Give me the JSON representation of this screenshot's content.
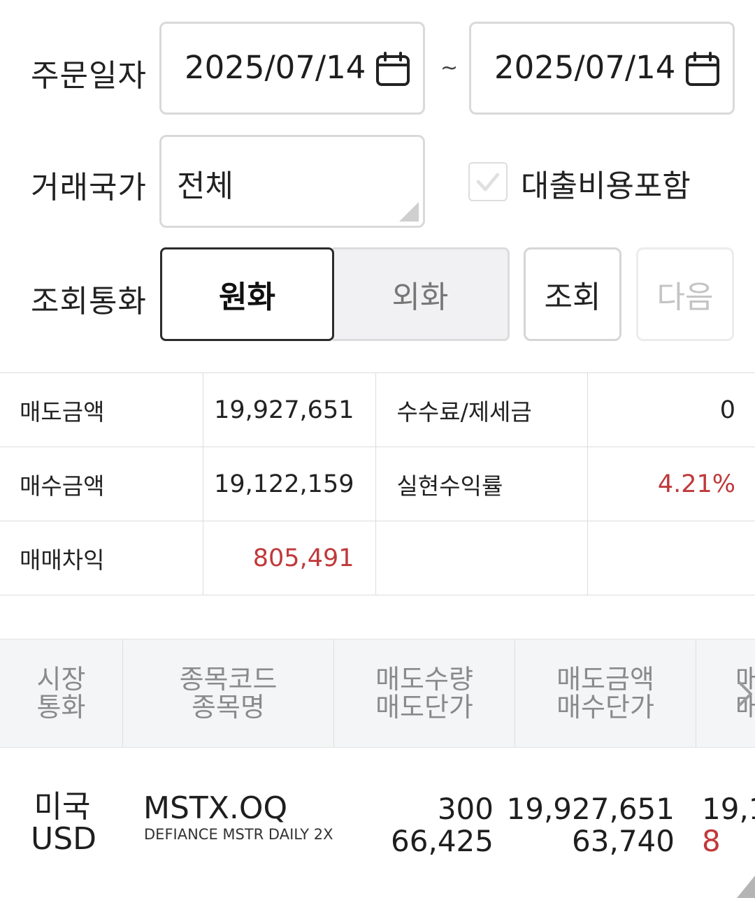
{
  "filters": {
    "order_date": {
      "label": "주문일자",
      "from": "2025/07/14",
      "separator": "~",
      "to": "2025/07/14",
      "icon": "calendar-icon"
    },
    "country": {
      "label": "거래국가",
      "value": "전체"
    },
    "loan_fee": {
      "label": "대출비용포함",
      "checked": true
    },
    "currency": {
      "label": "조회통화",
      "options": [
        "원화",
        "외화"
      ],
      "selected": "원화"
    },
    "buttons": {
      "query": "조회",
      "next": "다음"
    }
  },
  "summary": {
    "rows": [
      {
        "label": "매도금액",
        "value": "19,927,651",
        "label2": "수수료/제세금",
        "value2": "0"
      },
      {
        "label": "매수금액",
        "value": "19,122,159",
        "label2": "실현수익률",
        "value2": "4.21%"
      },
      {
        "label": "매매차익",
        "value": "805,491",
        "label2": "",
        "value2": ""
      }
    ]
  },
  "list": {
    "headers": [
      [
        "시장",
        "통화"
      ],
      [
        "종목코드",
        "종목명"
      ],
      [
        "매도수량",
        "매도단가"
      ],
      [
        "매도금액",
        "매수단가"
      ],
      [
        "매",
        "매"
      ]
    ],
    "rows": [
      {
        "market": "미국",
        "currency": "USD",
        "code": "MSTX.OQ",
        "name": "DEFIANCE MSTR DAILY 2X",
        "sell_qty": "300",
        "sell_price": "66,425",
        "sell_amount": "19,927,651",
        "buy_price": "63,740",
        "next_col_top": "19,1",
        "next_col_bottom": "8"
      }
    ]
  },
  "colors": {
    "positive": "#c0393b",
    "border": "#dcdcdc",
    "header_bg": "#f4f5f7",
    "selected_border": "#2b2b2b"
  }
}
